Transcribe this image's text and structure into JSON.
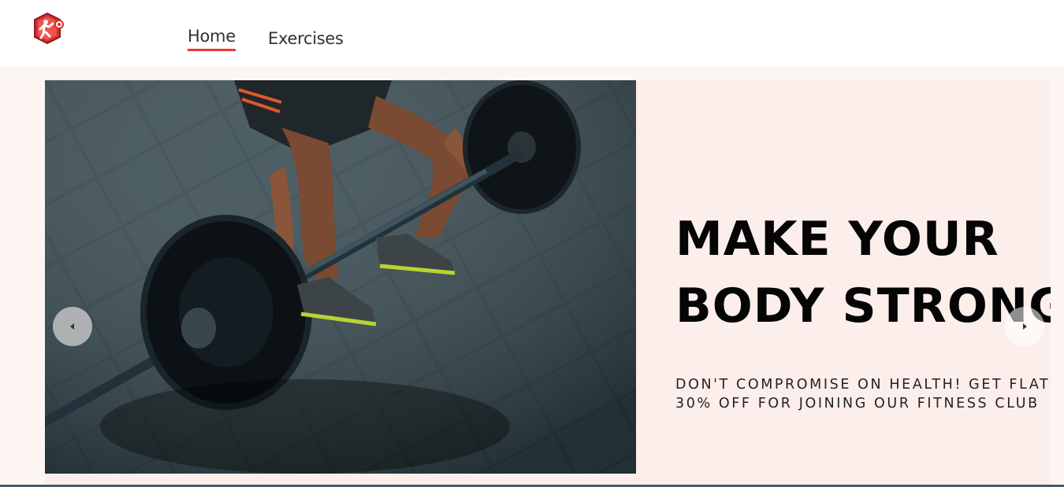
{
  "nav": {
    "logo_icon": "weightlifter-logo-icon",
    "links": [
      {
        "label": "Home",
        "active": true
      },
      {
        "label": "Exercises",
        "active": false
      }
    ]
  },
  "hero": {
    "title_lines": [
      "MAKE YOUR",
      "BODY STRONG"
    ],
    "subtitle_lines": [
      "DON'T COMPROMISE ON HEALTH! GET FLAT",
      "30% OFF FOR JOINING OUR FITNESS CLUB"
    ],
    "image_icon": "barbell-deadlift-photo",
    "prev_icon": "chevron-left-icon",
    "next_icon": "chevron-right-icon"
  },
  "colors": {
    "accent": "#e53935",
    "hero_bg": "#fcefeb",
    "page_bg": "#fdf5f2",
    "title": "#050505"
  }
}
